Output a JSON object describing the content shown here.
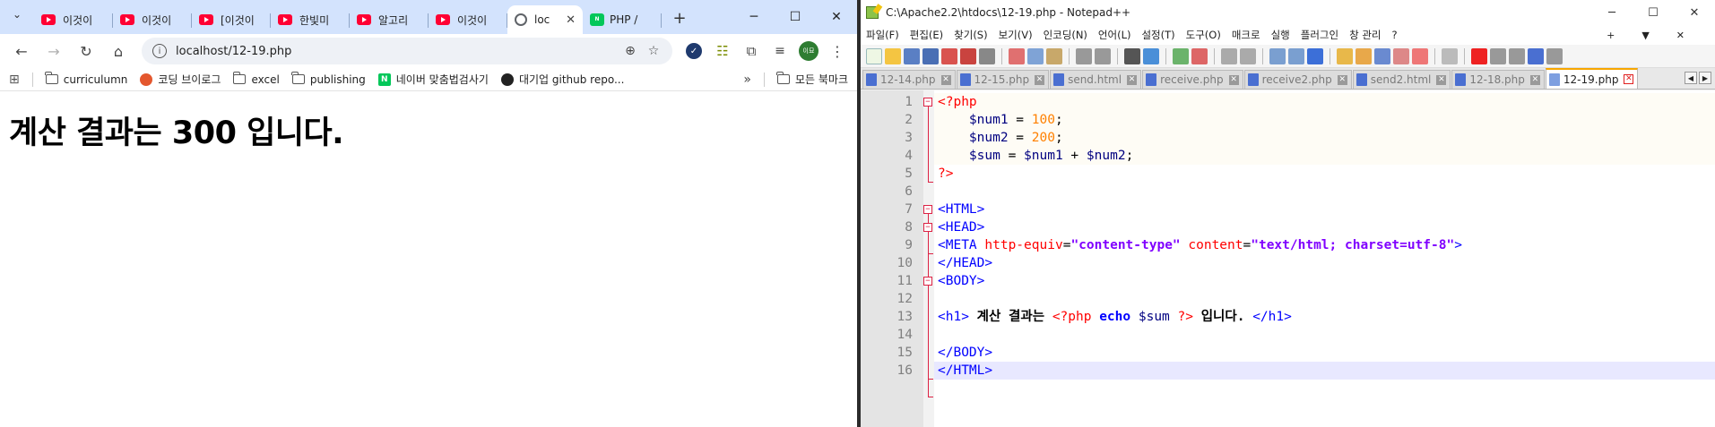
{
  "browser": {
    "tabs": [
      {
        "label": "이것이",
        "type": "youtube"
      },
      {
        "label": "이것이",
        "type": "youtube"
      },
      {
        "label": "[이것이",
        "type": "youtube"
      },
      {
        "label": "한빛미",
        "type": "youtube"
      },
      {
        "label": "알고리",
        "type": "youtube"
      },
      {
        "label": "이것이",
        "type": "youtube"
      },
      {
        "label": "loc",
        "type": "globe",
        "active": true
      },
      {
        "label": "PHP / ",
        "type": "naver"
      }
    ],
    "url": "localhost/12-19.php",
    "profile_initials": "이묘",
    "bookmarks": [
      {
        "label": "curriculumn",
        "icon": "folder-icon"
      },
      {
        "label": "코딩 브이로그",
        "icon": "blog-icon"
      },
      {
        "label": "excel",
        "icon": "folder-icon"
      },
      {
        "label": "publishing",
        "icon": "folder-icon"
      },
      {
        "label": "네이버 맞춤법검사기",
        "icon": "naver-icon"
      },
      {
        "label": "대기업 github repo...",
        "icon": "github-icon"
      }
    ],
    "all_bookmarks_label": "모든 북마크",
    "page_heading": "계산 결과는 300 입니다."
  },
  "notepad": {
    "title": "C:\\Apache2.2\\htdocs\\12-19.php - Notepad++",
    "menu": [
      "파일(F)",
      "편집(E)",
      "찾기(S)",
      "보기(V)",
      "인코딩(N)",
      "언어(L)",
      "설정(T)",
      "도구(O)",
      "매크로",
      "실행",
      "플러그인",
      "창 관리",
      "?"
    ],
    "tabs": [
      "12-14.php",
      "12-15.php",
      "send.html",
      "receive.php",
      "receive2.php",
      "send2.html",
      "12-18.php",
      "12-19.php"
    ],
    "active_tab": "12-19.php",
    "line_numbers": [
      "1",
      "2",
      "3",
      "4",
      "5",
      "6",
      "7",
      "8",
      "9",
      "10",
      "11",
      "12",
      "13",
      "14",
      "15",
      "16"
    ],
    "code": {
      "l1": "<?php",
      "l2_var": "$num1",
      "l2_op": " = ",
      "l2_num": "100",
      "l2_end": ";",
      "l3_var": "$num2",
      "l3_op": " = ",
      "l3_num": "200",
      "l3_end": ";",
      "l4_var": "$sum",
      "l4_op": " = ",
      "l4_var2": "$num1",
      "l4_plus": " + ",
      "l4_var3": "$num2",
      "l4_end": ";",
      "l5": "?>",
      "l7": "<HTML>",
      "l8": "<HEAD>",
      "l9_tag": "<META ",
      "l9_attr1": "http-equiv",
      "l9_eq1": "=",
      "l9_val1": "\"content-type\"",
      "l9_attr2": " content",
      "l9_eq2": "=",
      "l9_val2": "\"text/html; charset=utf-8\"",
      "l9_close": ">",
      "l10": "</HEAD>",
      "l11": "<BODY>",
      "l13_open": "<h1>",
      "l13_text": " 계산 결과는 ",
      "l13_phpopen": "<?php",
      "l13_echo": " echo ",
      "l13_var": "$sum",
      "l13_phpclose": " ?>",
      "l13_text2": " 입니다. ",
      "l13_close": "</h1>",
      "l15": "</BODY>",
      "l16": "</HTML>"
    }
  }
}
